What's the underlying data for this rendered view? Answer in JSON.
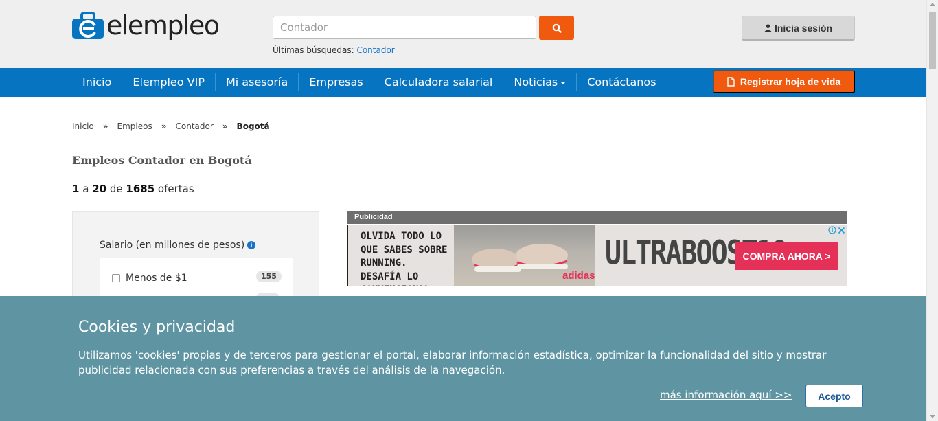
{
  "header": {
    "logo_text": "elempleo",
    "search_placeholder": "Contador",
    "recent_label": "Últimas búsquedas:",
    "recent_link": "Contador",
    "login_label": "Inicia sesión"
  },
  "nav": {
    "items": [
      "Inicio",
      "Elempleo VIP",
      "Mi asesoría",
      "Empresas",
      "Calculadora salarial",
      "Noticias",
      "Contáctanos"
    ],
    "cv_button": "Registrar hoja de vida"
  },
  "breadcrumb": {
    "items": [
      "Inicio",
      "Empleos",
      "Contador"
    ],
    "current": "Bogotá",
    "separator": "»"
  },
  "main": {
    "title": "Empleos Contador en Bogotá",
    "results": {
      "from": "1",
      "a": "a",
      "to": "20",
      "de": "de",
      "total": "1685",
      "label": "ofertas"
    }
  },
  "filter": {
    "title": "Salario (en millones de pesos)",
    "info_icon": "i",
    "options": [
      {
        "label": "Menos de $1",
        "count": "155"
      }
    ]
  },
  "ad": {
    "label": "Publicidad",
    "text": "OLVIDA TODO LO QUE SABES SOBRE RUNNING. DESAFÍA LO CONVENCIONAL.",
    "brand": "ULTRABOOST19",
    "cta": "COMPRA AHORA >",
    "logo": "adidas"
  },
  "cookie": {
    "title": "Cookies y privacidad",
    "text": "Utilizamos 'cookies' propias y de terceros para gestionar el portal, elaborar información estadística, optimizar la funcionalidad del sitio y mostrar publicidad relacionada con sus preferencias a través del análisis de la navegación.",
    "more_link": "más información aquí >>",
    "accept": "Acepto"
  },
  "colors": {
    "brand_blue": "#0774c1",
    "accent_orange": "#f05a0e",
    "cookie_bg": "#5f95a3"
  }
}
